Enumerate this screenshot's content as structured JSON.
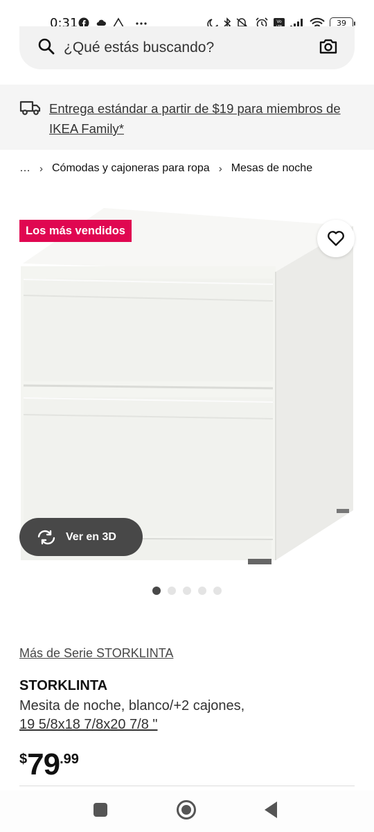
{
  "status_bar": {
    "time": "0:31",
    "battery": "39",
    "left_icons": [
      "facebook-icon",
      "cloud-icon",
      "drive-icon",
      "more-dots-icon"
    ],
    "right_icons": [
      "moon-icon",
      "bluetooth-icon",
      "mute-icon",
      "alarm-icon",
      "volte-icon",
      "signal-icon",
      "wifi-icon",
      "battery-icon"
    ]
  },
  "search": {
    "placeholder": "¿Qué estás buscando?"
  },
  "delivery": {
    "text": "Entrega estándar a partir de $19 para miembros de IKEA Family*"
  },
  "breadcrumb": {
    "items": [
      "…",
      "Cómodas y cajoneras para ropa",
      "Mesas de noche"
    ]
  },
  "product": {
    "badge": "Los más vendidos",
    "view_3d_label": "Ver en 3D",
    "series_link": "Más de Serie STORKLINTA",
    "name": "STORKLINTA",
    "description": "Mesita de noche, blanco/+2 cajones,",
    "size": "19 5/8x18 7/8x20 7/8 \"",
    "price": {
      "currency": "$",
      "integer": "79",
      "decimal": ".99"
    },
    "image_count": 5,
    "active_image": 1
  },
  "colors": {
    "badge": "#e00751",
    "button_dark": "#484848",
    "banner_bg": "#f5f5f5"
  },
  "nav": {
    "icons": [
      "recents-icon",
      "home-icon",
      "back-icon"
    ]
  }
}
